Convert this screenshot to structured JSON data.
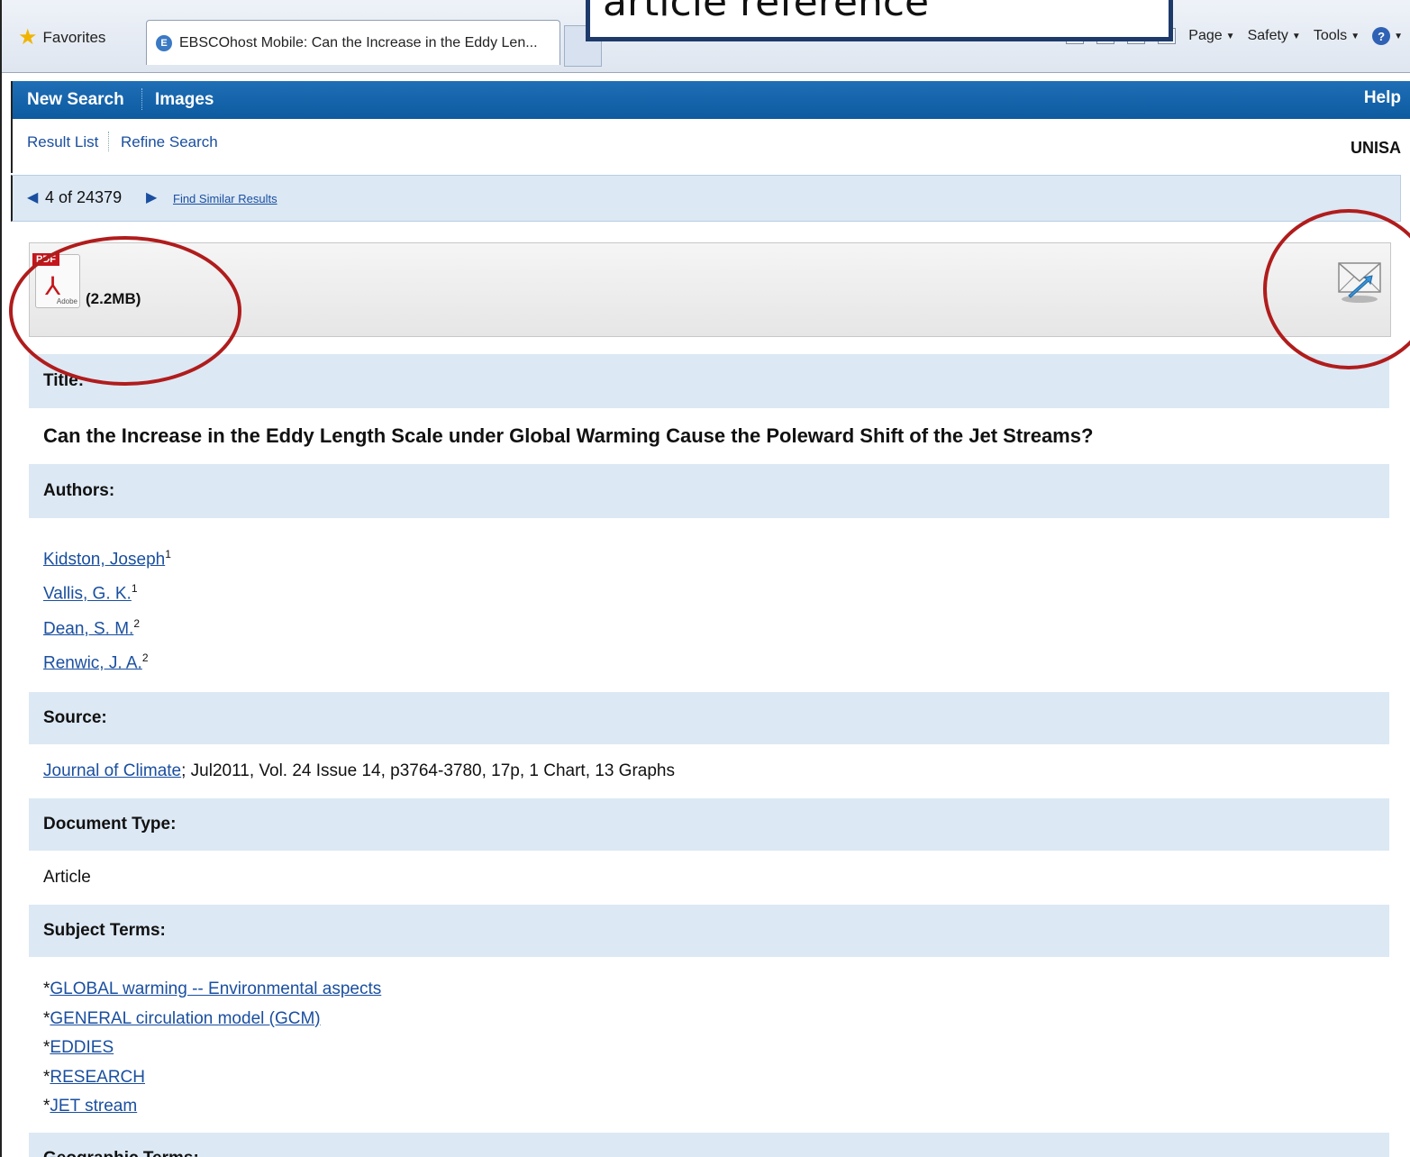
{
  "browser": {
    "favorites_label": "Favorites",
    "tab_title": "EBSCOhost Mobile: Can the Increase in the Eddy Len...",
    "menu": [
      "Page",
      "Safety",
      "Tools"
    ]
  },
  "callout_text": "article reference",
  "nav": {
    "new_search": "New Search",
    "images": "Images",
    "help": "Help"
  },
  "subnav": {
    "result_list": "Result List",
    "refine_search": "Refine Search",
    "institution": "UNISA"
  },
  "pager": {
    "count": "4 of 24379",
    "find_similar": "Find Similar Results"
  },
  "doc": {
    "pdf_size": "(2.2MB)"
  },
  "record": {
    "title_label": "Title:",
    "title": "Can the Increase in the Eddy Length Scale under Global Warming Cause the Poleward Shift of the Jet Streams?",
    "authors_label": "Authors:",
    "authors": [
      {
        "name": "Kidston, Joseph",
        "sup": "1"
      },
      {
        "name": "Vallis, G. K.",
        "sup": "1"
      },
      {
        "name": "Dean, S. M.",
        "sup": "2"
      },
      {
        "name": "Renwic, J. A.",
        "sup": "2"
      }
    ],
    "source_label": "Source:",
    "source_journal": "Journal of Climate",
    "source_detail": "; Jul2011, Vol. 24 Issue 14, p3764-3780, 17p, 1 Chart, 13 Graphs",
    "doctype_label": "Document Type:",
    "doctype": "Article",
    "subjects_label": "Subject Terms:",
    "subject_prefix": "*",
    "subjects": [
      "GLOBAL warming -- Environmental aspects",
      "GENERAL circulation model (GCM)",
      "EDDIES",
      "RESEARCH",
      "JET stream"
    ],
    "geo_label": "Geographic Terms:"
  }
}
